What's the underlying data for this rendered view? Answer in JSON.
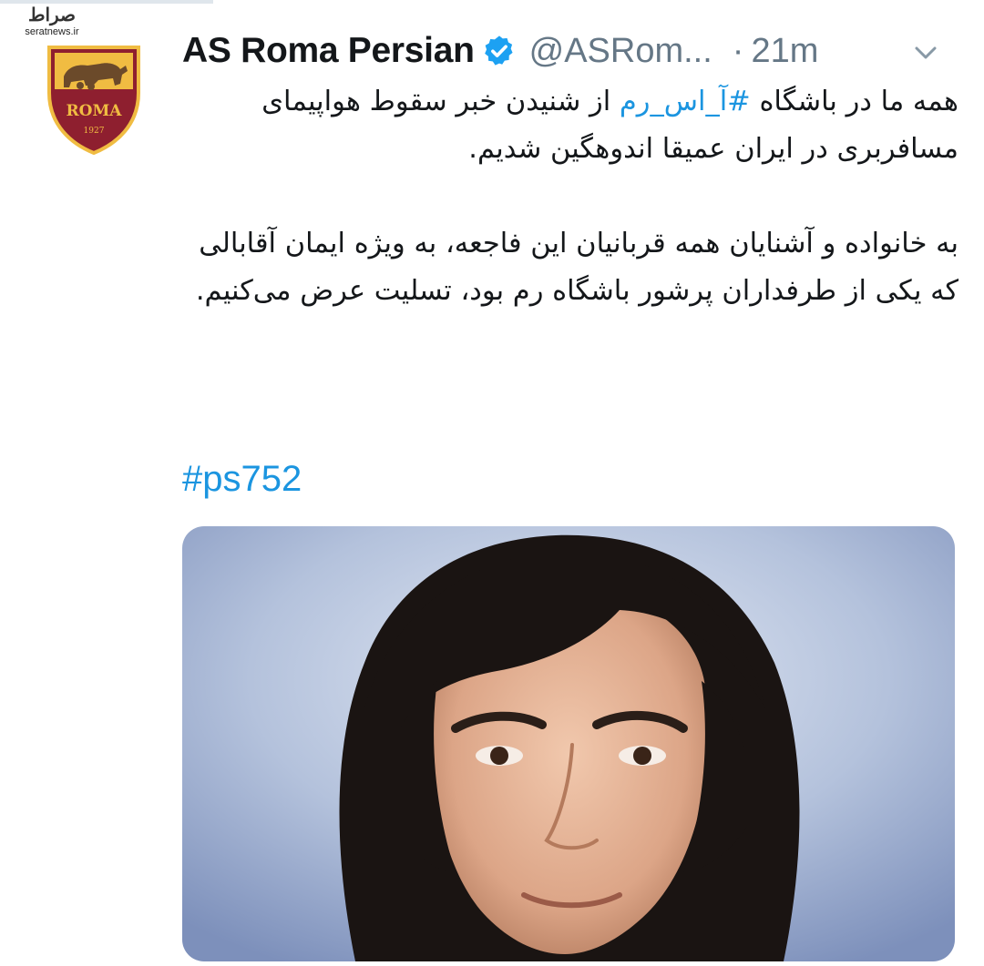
{
  "watermark": {
    "logo_text": "صراط",
    "url": "seratnews.ir"
  },
  "tweet": {
    "display_name": "AS Roma Persian",
    "handle": "@ASRom...",
    "separator": "·",
    "time": "21m",
    "paragraph1_before": "همه ما در باشگاه",
    "paragraph1_hashtag": "#آ_اس_رم",
    "paragraph1_after": "از شنیدن خبر سقوط هواپیمای مسافربری در ایران عمیقا اندوهگین شدیم.",
    "paragraph2": "به خانواده و آشنایان همه قربانیان این فاجعه، به ویژه ایمان آقابالی که یکی از طرفداران پرشور باشگاه رم بود، تسلیت عرض می‌کنیم.",
    "hashtag": "#ps752"
  },
  "crest": {
    "text": "ROMA",
    "year": "1927"
  },
  "colors": {
    "link": "#1b95e0",
    "muted": "#657786",
    "roma_red": "#8e1f2f",
    "roma_gold": "#f0bc42"
  }
}
